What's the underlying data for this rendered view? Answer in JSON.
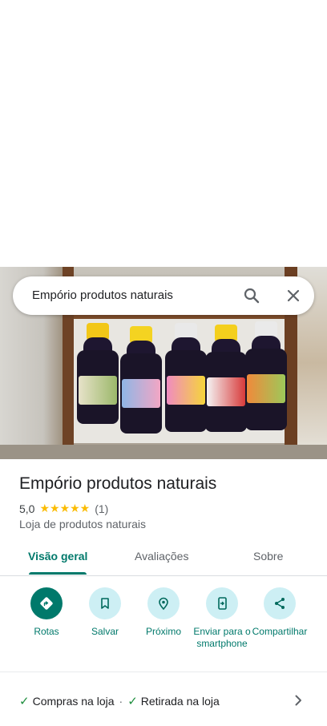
{
  "search": {
    "query": "Empório produtos naturais"
  },
  "place": {
    "title": "Empório produtos naturais",
    "rating": "5,0",
    "stars": "★★★★★",
    "review_count": "(1)",
    "category": "Loja de produtos naturais"
  },
  "tabs": [
    {
      "label": "Visão geral",
      "active": true
    },
    {
      "label": "Avaliações",
      "active": false
    },
    {
      "label": "Sobre",
      "active": false
    }
  ],
  "actions": [
    {
      "label": "Rotas",
      "icon": "directions-icon"
    },
    {
      "label": "Salvar",
      "icon": "bookmark-icon"
    },
    {
      "label": "Próximo",
      "icon": "nearby-icon"
    },
    {
      "label": "Enviar para o smartphone",
      "icon": "send-to-phone-icon"
    },
    {
      "label": "Compartilhar",
      "icon": "share-icon"
    }
  ],
  "services": [
    {
      "label": "Compras na loja"
    },
    {
      "label": "Retirada na loja"
    }
  ],
  "colors": {
    "accent": "#00796b",
    "action_bg": "#cdeff4",
    "star": "#fbbc04",
    "check": "#1e8e3e"
  }
}
